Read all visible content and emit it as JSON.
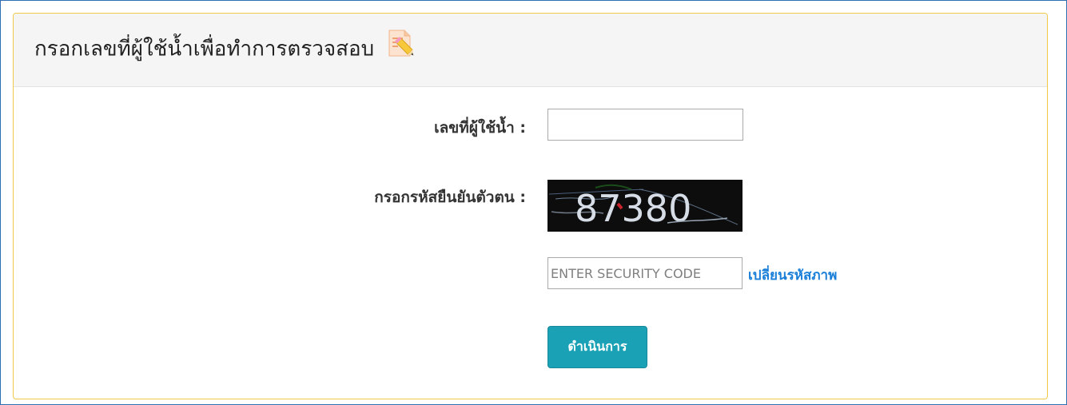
{
  "panel": {
    "title": "กรอกเลขที่ผู้ใช้น้ำเพื่อทำการตรวจสอบ",
    "title_icon": "edit-note-icon"
  },
  "form": {
    "water_user_label": "เลขที่ผู้ใช้น้ำ :",
    "water_user_value": "",
    "captcha_label": "กรอกรหัสยืนยันตัวตน :",
    "captcha_text": "87380",
    "security_placeholder": "ENTER SECURITY CODE",
    "security_value": "",
    "refresh_link": "เปลี่ยนรหัสภาพ",
    "submit_label": "ดำเนินการ"
  },
  "colors": {
    "panel_border": "#f0c94a",
    "link": "#1a7fd8",
    "button": "#1ba1b5"
  }
}
